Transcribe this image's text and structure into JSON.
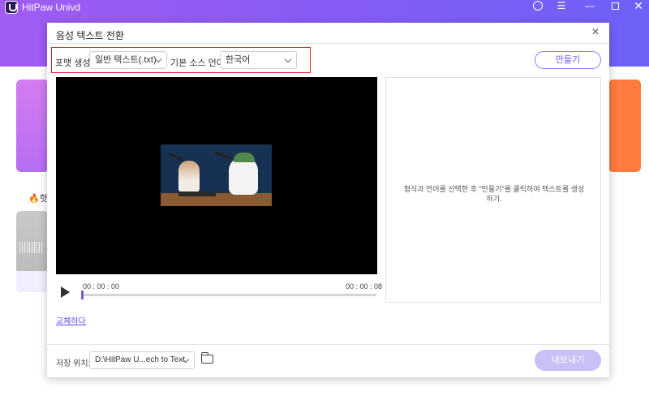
{
  "app": {
    "title": "HitPaw Univd",
    "hot_label": "핫"
  },
  "dialog": {
    "title": "음성 텍스트 전환",
    "close_symbol": "×"
  },
  "options": {
    "format_label": "포맷 생성:",
    "format_value": "일반 텍스트(.txt)",
    "language_label": "기본 소스 언어:",
    "language_value": "한국어"
  },
  "buttons": {
    "make": "만들기",
    "export": "내보내기",
    "replace": "교체하다"
  },
  "player": {
    "current_time": "00 : 00 : 00",
    "total_time": "00 : 00 : 08",
    "progress_fraction": 0
  },
  "text_panel": {
    "message": "형식과 언어를 선택한 후 \"만들기\"를 클릭하여 텍스트를 생성하기."
  },
  "save": {
    "label": "저장 위치:",
    "path": "D:\\HitPaw U...ech to Text"
  },
  "colors": {
    "accent": "#6b5bf2",
    "header_gradient_start": "#a05cf2",
    "header_gradient_end": "#6d61f7",
    "highlight_border": "#e0242e",
    "export_disabled": "#c9c0f7"
  },
  "icons": [
    "app-logo-icon",
    "user-icon",
    "menu-icon",
    "minimize-icon",
    "maximize-icon",
    "close-icon",
    "play-icon",
    "folder-icon",
    "chevron-down-icon",
    "flame-icon"
  ]
}
